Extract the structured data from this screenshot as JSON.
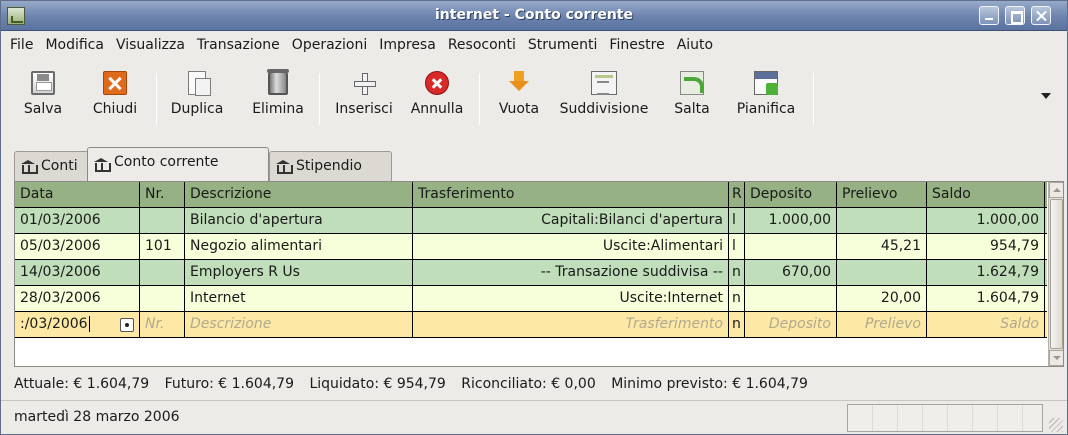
{
  "window": {
    "title": "internet - Conto corrente"
  },
  "menubar": [
    "File",
    "Modifica",
    "Visualizza",
    "Transazione",
    "Operazioni",
    "Impresa",
    "Resoconti",
    "Strumenti",
    "Finestre",
    "Aiuto"
  ],
  "toolbar": {
    "save": "Salva",
    "close": "Chiudi",
    "duplicate": "Duplica",
    "delete": "Elimina",
    "insert": "Inserisci",
    "cancel": "Annulla",
    "void": "Vuota",
    "split": "Suddivisione",
    "jump": "Salta",
    "schedule": "Pianifica"
  },
  "tabs": [
    {
      "label": "Conti",
      "active": false
    },
    {
      "label": "Conto corrente",
      "active": true
    },
    {
      "label": "Stipendio",
      "active": false
    }
  ],
  "register": {
    "headers": {
      "date": "Data",
      "num": "Nr.",
      "desc": "Descrizione",
      "xfer": "Trasferimento",
      "r": "R",
      "dep": "Deposito",
      "wd": "Prelievo",
      "bal": "Saldo"
    },
    "rows": [
      {
        "date": "01/03/2006",
        "num": "",
        "desc": "Bilancio d'apertura",
        "xfer": "Capitali:Bilanci d'apertura",
        "r": "l",
        "dep": "1.000,00",
        "wd": "",
        "bal": "1.000,00"
      },
      {
        "date": "05/03/2006",
        "num": "101",
        "desc": "Negozio alimentari",
        "xfer": "Uscite:Alimentari",
        "r": "l",
        "dep": "",
        "wd": "45,21",
        "bal": "954,79"
      },
      {
        "date": "14/03/2006",
        "num": "",
        "desc": "Employers R Us",
        "xfer": "-- Transazione suddivisa --",
        "r": "n",
        "dep": "670,00",
        "wd": "",
        "bal": "1.624,79"
      },
      {
        "date": "28/03/2006",
        "num": "",
        "desc": "Internet",
        "xfer": "Uscite:Internet",
        "r": "n",
        "dep": "",
        "wd": "20,00",
        "bal": "1.604,79"
      }
    ],
    "blank": {
      "date": ":/03/2006",
      "num": "Nr.",
      "desc": "Descrizione",
      "xfer": "Trasferimento",
      "r": "n",
      "dep": "Deposito",
      "wd": "Prelievo",
      "bal": "Saldo"
    }
  },
  "summary": {
    "present": "Attuale: € 1.604,79",
    "future": "Futuro: € 1.604,79",
    "cleared": "Liquidato: € 954,79",
    "reconciled": "Riconciliato: € 0,00",
    "projected_min": "Minimo previsto: € 1.604,79"
  },
  "status": {
    "text": "martedì 28 marzo 2006"
  }
}
